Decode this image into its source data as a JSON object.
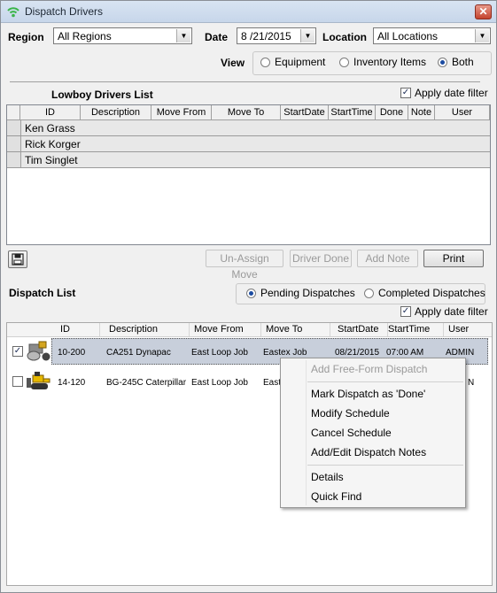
{
  "window": {
    "title": "Dispatch Drivers",
    "close_glyph": "✕"
  },
  "filters": {
    "region_label": "Region",
    "region_value": "All Regions",
    "date_label": "Date",
    "date_value": "8 /21/2015",
    "location_label": "Location",
    "location_value": "All Locations",
    "view_label": "View",
    "view_options": [
      "Equipment",
      "Inventory Items",
      "Both"
    ],
    "view_selected": "Both"
  },
  "lowboy": {
    "title": "Lowboy Drivers List",
    "apply_date_filter": "Apply date filter",
    "apply_date_filter_checked": true,
    "columns": [
      "ID",
      "Description",
      "Move From",
      "Move To",
      "StartDate",
      "StartTime",
      "Done",
      "Note",
      "User"
    ],
    "drivers": [
      "Ken Grass",
      "Rick Korger",
      "Tim Singlet"
    ]
  },
  "buttons": {
    "save_icon": "floppy-disk-icon",
    "unassign": "Un-Assign Move",
    "driver_done": "Driver Done",
    "add_note": "Add Note",
    "print": "Print"
  },
  "dispatch": {
    "title": "Dispatch List",
    "pending": "Pending Dispatches",
    "completed": "Completed Dispatches",
    "selected_tab": "Pending Dispatches",
    "apply_date_filter": "Apply date filter",
    "apply_date_filter_checked": true,
    "columns": [
      "ID",
      "Description",
      "Move From",
      "Move To",
      "StartDate",
      "StartTime",
      "User"
    ],
    "rows": [
      {
        "checked": true,
        "icon": "roller-compactor-icon",
        "id": "10-200",
        "description": "CA251 Dynapac",
        "move_from": "East Loop Job",
        "move_to": "Eastex Job",
        "start_date": "08/21/2015",
        "start_time": "07:00  AM",
        "user": "ADMIN"
      },
      {
        "checked": false,
        "icon": "bulldozer-icon",
        "id": "14-120",
        "description": "BG-245C Caterpillar",
        "move_from": "East Loop Job",
        "move_to": "Easte",
        "start_date": "",
        "start_time": "",
        "user": "N"
      }
    ]
  },
  "context_menu": {
    "items": [
      {
        "label": "Add Free-Form Dispatch",
        "enabled": false
      },
      {
        "label": "Mark Dispatch as 'Done'",
        "enabled": true
      },
      {
        "label": "Modify Schedule",
        "enabled": true
      },
      {
        "label": "Cancel Schedule",
        "enabled": true
      },
      {
        "label": "Add/Edit Dispatch Notes",
        "enabled": true
      },
      {
        "label": "Details",
        "enabled": true
      },
      {
        "label": "Quick Find",
        "enabled": true
      }
    ]
  },
  "colors": {
    "selection_row": "#c8cfdb",
    "title_bar": "#c7d6ea",
    "radio_dot": "#1b4ba1"
  }
}
